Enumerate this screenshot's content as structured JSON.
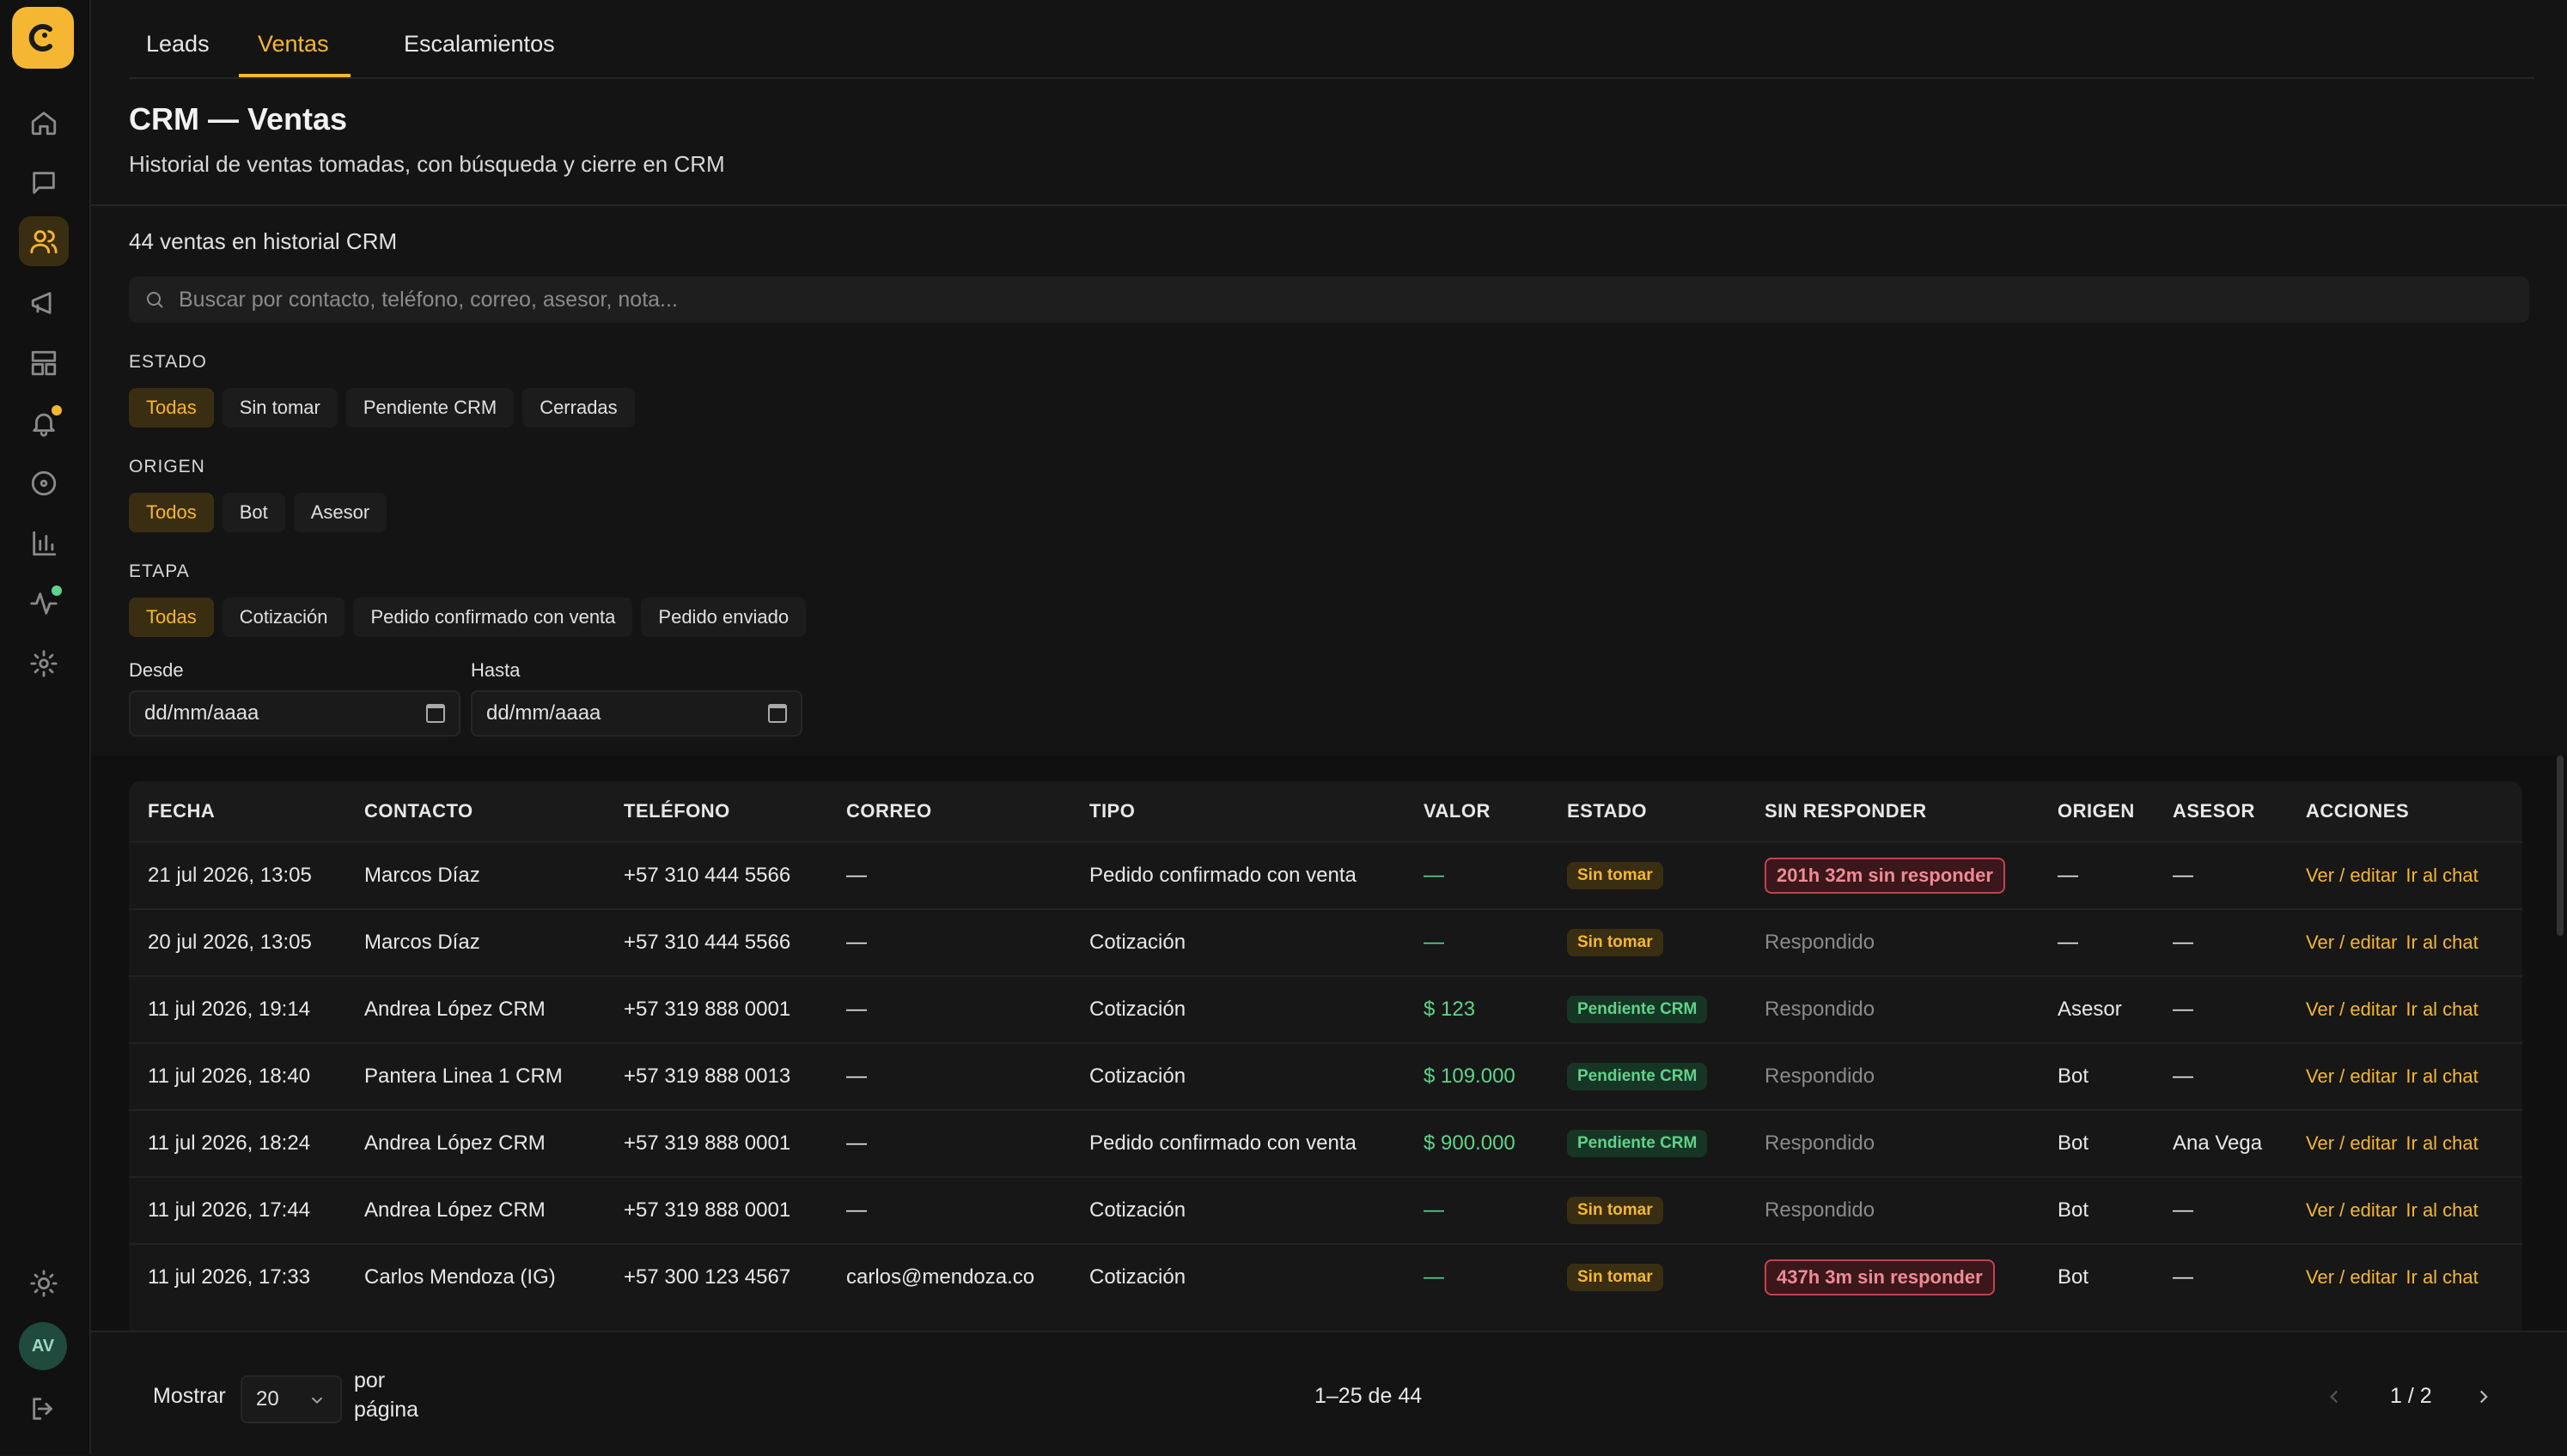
{
  "tabs": [
    {
      "label": "Leads"
    },
    {
      "label": "Ventas"
    },
    {
      "label": "Escalamientos"
    }
  ],
  "active_tab": "Ventas",
  "header": {
    "title": "CRM — Ventas",
    "subtitle": "Historial de ventas tomadas, con búsqueda y cierre en CRM"
  },
  "count_text": "44 ventas en historial CRM",
  "search": {
    "placeholder": "Buscar por contacto, teléfono, correo, asesor, nota...",
    "value": ""
  },
  "filters": {
    "estado": {
      "label": "ESTADO",
      "options": [
        "Todas",
        "Sin tomar",
        "Pendiente CRM",
        "Cerradas"
      ],
      "selected": "Todas"
    },
    "origen": {
      "label": "ORIGEN",
      "options": [
        "Todos",
        "Bot",
        "Asesor"
      ],
      "selected": "Todos"
    },
    "etapa": {
      "label": "ETAPA",
      "options": [
        "Todas",
        "Cotización",
        "Pedido confirmado con venta",
        "Pedido enviado"
      ],
      "selected": "Todas"
    }
  },
  "dates": {
    "desde": {
      "label": "Desde",
      "value": "dd/mm/aaaa"
    },
    "hasta": {
      "label": "Hasta",
      "value": "dd/mm/aaaa"
    }
  },
  "table": {
    "columns": [
      "FECHA",
      "CONTACTO",
      "TELÉFONO",
      "CORREO",
      "TIPO",
      "VALOR",
      "ESTADO",
      "SIN RESPONDER",
      "ORIGEN",
      "ASESOR",
      "ACCIONES"
    ],
    "action_labels": {
      "edit": "Ver / editar",
      "chat": "Ir al chat"
    },
    "rows": [
      {
        "fecha": "21 jul 2026, 13:05",
        "contacto": "Marcos Díaz",
        "telefono": "+57 310 444 5566",
        "correo": "—",
        "tipo": "Pedido confirmado con venta",
        "valor": "—",
        "estado": "Sin tomar",
        "sin_responder": "201h 32m sin responder",
        "alert": true,
        "origen": "—",
        "asesor": "—"
      },
      {
        "fecha": "20 jul 2026, 13:05",
        "contacto": "Marcos Díaz",
        "telefono": "+57 310 444 5566",
        "correo": "—",
        "tipo": "Cotización",
        "valor": "—",
        "estado": "Sin tomar",
        "sin_responder": "Respondido",
        "alert": false,
        "origen": "—",
        "asesor": "—"
      },
      {
        "fecha": "11 jul 2026, 19:14",
        "contacto": "Andrea López CRM",
        "telefono": "+57 319 888 0001",
        "correo": "—",
        "tipo": "Cotización",
        "valor": "$ 123",
        "estado": "Pendiente CRM",
        "sin_responder": "Respondido",
        "alert": false,
        "origen": "Asesor",
        "asesor": "—"
      },
      {
        "fecha": "11 jul 2026, 18:40",
        "contacto": "Pantera Linea 1 CRM",
        "telefono": "+57 319 888 0013",
        "correo": "—",
        "tipo": "Cotización",
        "valor": "$ 109.000",
        "estado": "Pendiente CRM",
        "sin_responder": "Respondido",
        "alert": false,
        "origen": "Bot",
        "asesor": "—"
      },
      {
        "fecha": "11 jul 2026, 18:24",
        "contacto": "Andrea López CRM",
        "telefono": "+57 319 888 0001",
        "correo": "—",
        "tipo": "Pedido confirmado con venta",
        "valor": "$ 900.000",
        "estado": "Pendiente CRM",
        "sin_responder": "Respondido",
        "alert": false,
        "origen": "Bot",
        "asesor": "Ana Vega"
      },
      {
        "fecha": "11 jul 2026, 17:44",
        "contacto": "Andrea López CRM",
        "telefono": "+57 319 888 0001",
        "correo": "—",
        "tipo": "Cotización",
        "valor": "—",
        "estado": "Sin tomar",
        "sin_responder": "Respondido",
        "alert": false,
        "origen": "Bot",
        "asesor": "—"
      },
      {
        "fecha": "11 jul 2026, 17:33",
        "contacto": "Carlos Mendoza (IG)",
        "telefono": "+57 300 123 4567",
        "correo": "carlos@mendoza.co",
        "tipo": "Cotización",
        "valor": "—",
        "estado": "Sin tomar",
        "sin_responder": "437h 3m sin responder",
        "alert": true,
        "origen": "Bot",
        "asesor": "—"
      }
    ]
  },
  "footer": {
    "show_label": "Mostrar",
    "page_size": "20",
    "per_page_label_1": "por",
    "per_page_label_2": "página",
    "range_text": "1–25 de 44",
    "page_indicator": "1 / 2"
  },
  "user": {
    "initials": "AV"
  },
  "colors": {
    "accent": "#f5b731",
    "success": "#5fd38a",
    "danger": "#f08a94",
    "background": "#141414"
  },
  "icons": [
    "app-logo-icon",
    "home-icon",
    "chat-icon",
    "users-icon",
    "megaphone-icon",
    "layout-icon",
    "bell-icon",
    "circle-icon",
    "bar-chart-icon",
    "activity-icon",
    "settings-icon",
    "sun-icon",
    "logout-icon"
  ]
}
